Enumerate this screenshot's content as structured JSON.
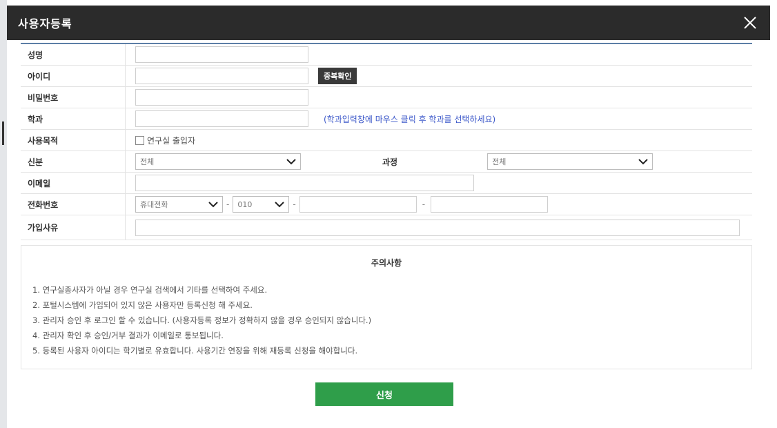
{
  "modal": {
    "title": "사용자등록"
  },
  "form": {
    "name": {
      "label": "성명",
      "value": ""
    },
    "user_id": {
      "label": "아이디",
      "value": "",
      "check_button": "중복확인"
    },
    "password": {
      "label": "비밀번호",
      "value": ""
    },
    "department": {
      "label": "학과",
      "value": "",
      "hint": "(학과입력창에 마우스 클릭 후 학과를 선택하세요)"
    },
    "purpose": {
      "label": "사용목적",
      "checkbox_label": "연구실 출입자",
      "checked": false
    },
    "status": {
      "label": "신분",
      "selected": "전체"
    },
    "course": {
      "label": "과정",
      "selected": "전체"
    },
    "email": {
      "label": "이메일",
      "value": ""
    },
    "phone": {
      "label": "전화번호",
      "type_selected": "휴대전화",
      "prefix_selected": "010",
      "middle": "",
      "last": ""
    },
    "reason": {
      "label": "가입사유",
      "value": ""
    }
  },
  "notice": {
    "title": "주의사항",
    "items": [
      "1. 연구실종사자가 아닐 경우 연구실 검색에서 기타를 선택하여 주세요.",
      "2. 포털시스템에 가입되어 있지 않은 사용자만 등록신청 해 주세요.",
      "3. 관리자 승인 후 로그인 할 수 있습니다. (사용자등록 정보가 정확하지 않을 경우 승인되지 않습니다.)",
      "4. 관리자 확인 후 승인/거부 결과가 이메일로 통보됩니다.",
      "5. 등록된 사용자 아이디는 학기별로 유효합니다. 사용기간 연장을 위해 재등록 신청을 해야합니다."
    ]
  },
  "submit": {
    "label": "신청"
  },
  "colors": {
    "titlebar": "#2b2b2b",
    "accent_rule": "#5b7ea6",
    "hint": "#3b57c9",
    "submit": "#2f9e4a"
  },
  "icons": {
    "close": "close-icon",
    "dropdown": "chevron-down-icon"
  }
}
